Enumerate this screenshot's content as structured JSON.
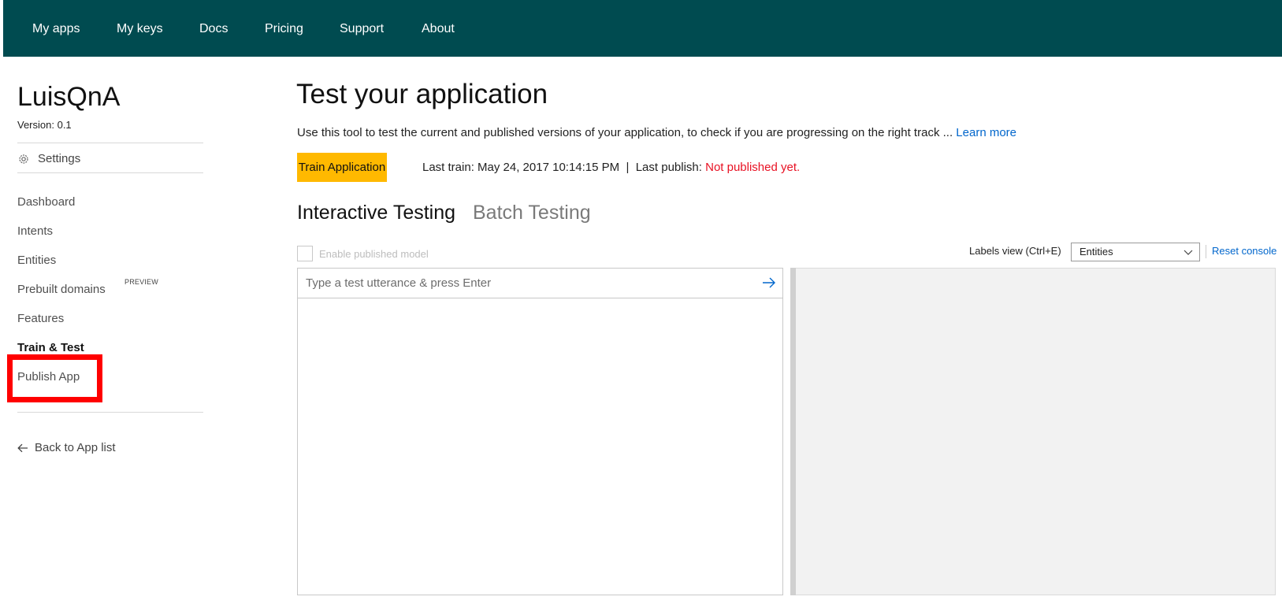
{
  "nav": {
    "items": [
      "My apps",
      "My keys",
      "Docs",
      "Pricing",
      "Support",
      "About"
    ]
  },
  "sidebar": {
    "app_name": "LuisQnA",
    "version": "Version:  0.1",
    "settings_label": "Settings",
    "items": [
      {
        "label": "Dashboard"
      },
      {
        "label": "Intents"
      },
      {
        "label": "Entities"
      },
      {
        "label": "Prebuilt domains",
        "badge": "PREVIEW"
      },
      {
        "label": "Features"
      },
      {
        "label": "Train & Test",
        "active": true
      },
      {
        "label": "Publish App"
      }
    ],
    "back_label": "Back to App list"
  },
  "main": {
    "title": "Test your application",
    "description": "Use this tool to test the current and published versions of your application, to check if you are progressing on the right track ...",
    "learn_more": "Learn more",
    "train_button": "Train Application",
    "last_train": "Last train: May 24, 2017 10:14:15 PM  |  Last publish: ",
    "last_publish_status": "Not published yet.",
    "tabs": [
      {
        "label": "Interactive Testing",
        "active": true
      },
      {
        "label": "Batch Testing",
        "active": false
      }
    ],
    "enable_published_label": "Enable published model",
    "labels_view_label": "Labels view (Ctrl+E)",
    "labels_view_selected": "Entities",
    "reset_console": "Reset console",
    "test_placeholder": "Type a test utterance & press Enter"
  },
  "colors": {
    "nav_bg": "#004b50",
    "train_button": "#ffb900",
    "not_published": "#e81123",
    "link": "#0066cc",
    "highlight": "#ff0000"
  }
}
